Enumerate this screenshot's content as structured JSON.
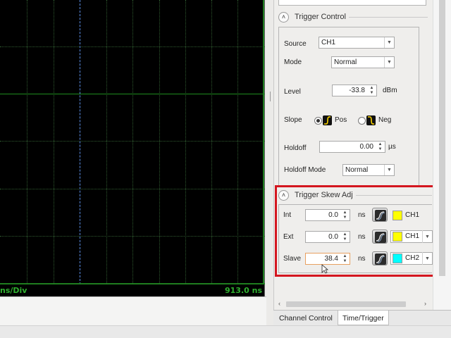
{
  "scope": {
    "time_per_div_label": "ns/Div",
    "time_value": "913.0 ns",
    "colors": {
      "background": "#000000",
      "grid": "#1e8c1e",
      "marker": "#5b8ee6"
    }
  },
  "trigger_control": {
    "title": "Trigger Control",
    "source_label": "Source",
    "source_value": "CH1",
    "mode_label": "Mode",
    "mode_value": "Normal",
    "level_label": "Level",
    "level_value": "-33.8",
    "level_unit": "dBm",
    "slope_label": "Slope",
    "slope_pos_label": "Pos",
    "slope_neg_label": "Neg",
    "slope_selected": "Pos",
    "holdoff_label": "Holdoff",
    "holdoff_value": "0.00",
    "holdoff_unit": "µs",
    "holdoff_mode_label": "Holdoff Mode",
    "holdoff_mode_value": "Normal"
  },
  "trigger_skew": {
    "title": "Trigger Skew Adj",
    "rows": [
      {
        "label": "Int",
        "value": "0.0",
        "unit": "ns",
        "channel": "CH1",
        "color": "#ffff00"
      },
      {
        "label": "Ext",
        "value": "0.0",
        "unit": "ns",
        "channel": "CH1",
        "color": "#ffff00"
      },
      {
        "label": "Slave",
        "value": "38.4",
        "unit": "ns",
        "channel": "CH2",
        "color": "#00ffff"
      }
    ],
    "highlight_color": "#d4161f"
  },
  "tabs": [
    {
      "label": "Channel Control",
      "active": false
    },
    {
      "label": "Time/Trigger",
      "active": true
    }
  ],
  "icons": {
    "collapse": "chevron-up-icon",
    "dropdown": "chevron-down-icon",
    "spin": "spin-arrows-icon",
    "slope_pos": "rising-edge-icon",
    "slope_neg": "falling-edge-icon",
    "skew": "skew-adjust-icon",
    "scroll_left": "chevron-left-icon",
    "scroll_right": "chevron-right-icon"
  }
}
